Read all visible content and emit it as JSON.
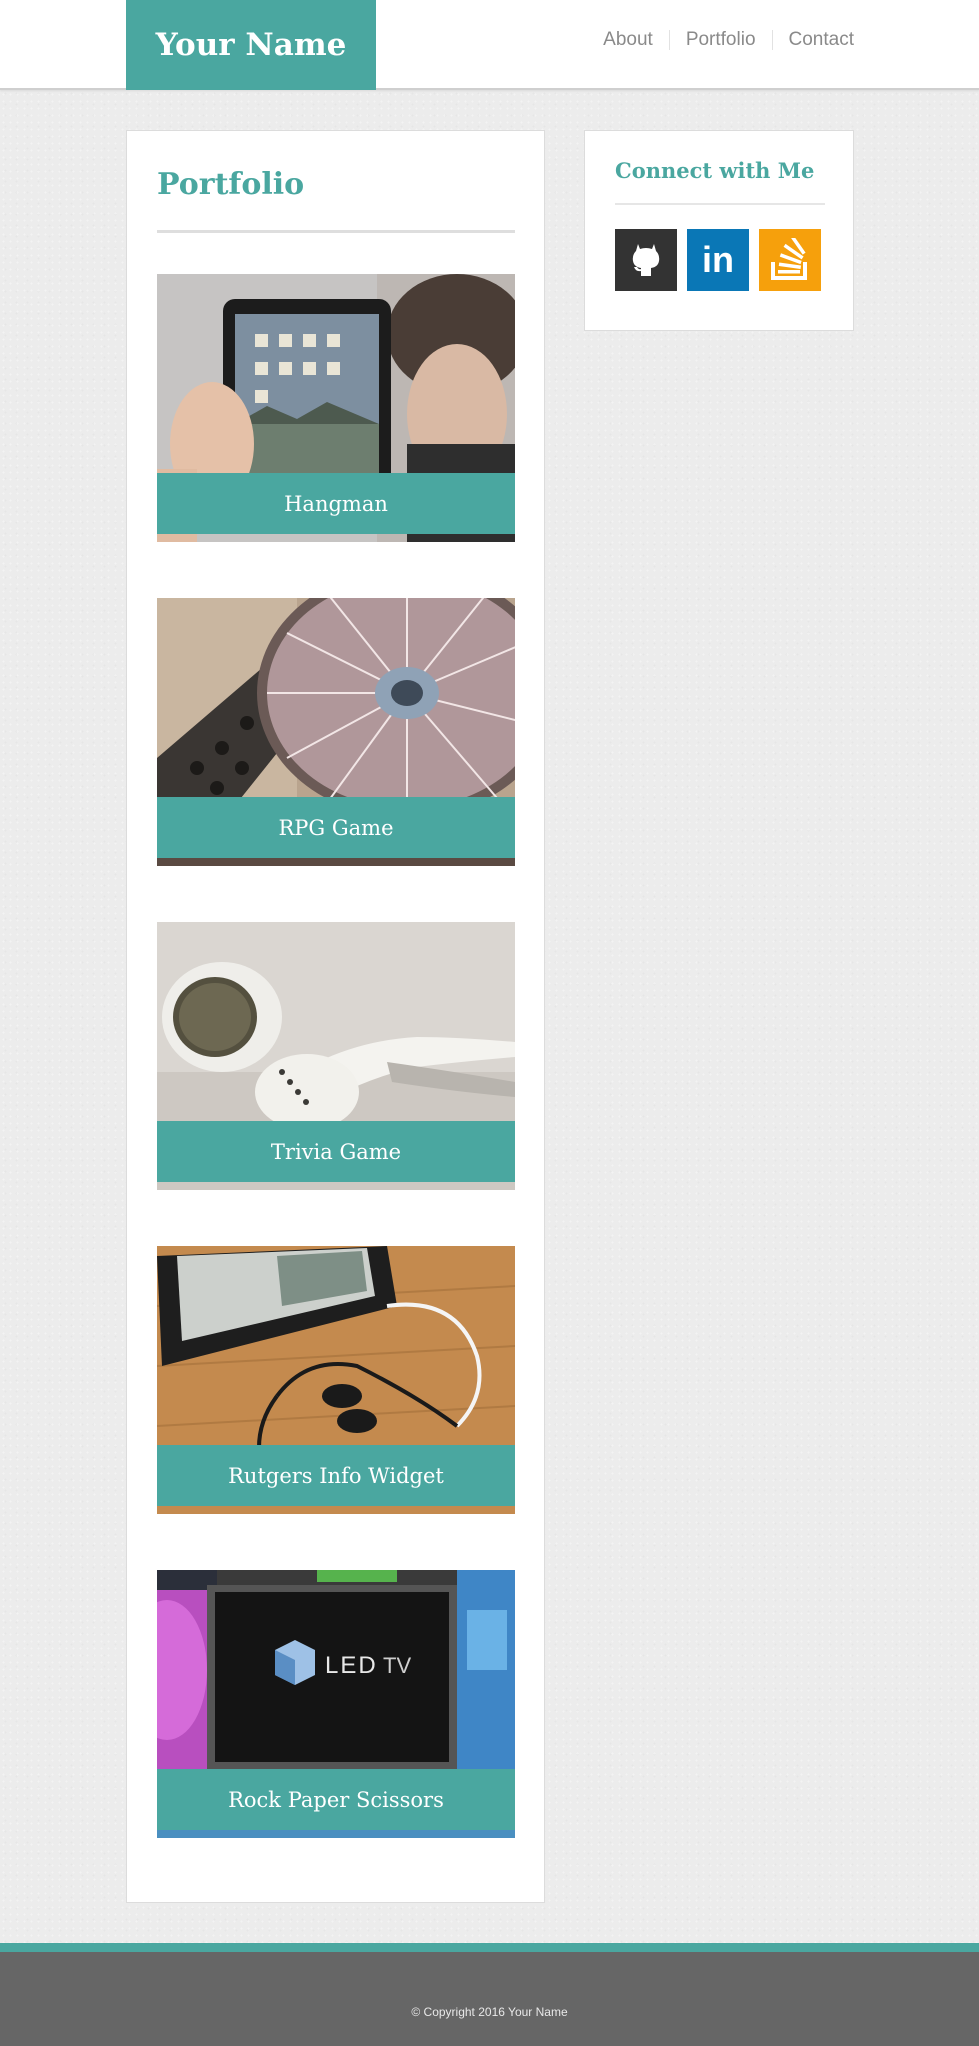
{
  "header": {
    "brand": "Your Name",
    "nav": [
      {
        "label": "About"
      },
      {
        "label": "Portfolio"
      },
      {
        "label": "Contact"
      }
    ]
  },
  "main": {
    "title": "Portfolio",
    "projects": [
      {
        "title": "Hangman",
        "image": "tablet-held-by-person-photo"
      },
      {
        "title": "RPG Game",
        "image": "dj-turntable-photo"
      },
      {
        "title": "Trivia Game",
        "image": "white-earbuds-photo"
      },
      {
        "title": "Rutgers Info Widget",
        "image": "phone-with-earphones-photo"
      },
      {
        "title": "Rock Paper Scissors",
        "image": "led-tv-display-photo"
      }
    ]
  },
  "sidebar": {
    "title": "Connect with Me",
    "social": [
      {
        "name": "github-icon",
        "color": "#333333"
      },
      {
        "name": "linkedin-icon",
        "color": "#0a77b6",
        "text": "in"
      },
      {
        "name": "stackoverflow-icon",
        "color": "#f6a00c"
      }
    ]
  },
  "footer": {
    "copyright": "© Copyright 2016 Your Name"
  },
  "colors": {
    "accent": "#4aa7a0",
    "footer_bg": "#666666",
    "nav_text": "#8a8a8a"
  }
}
